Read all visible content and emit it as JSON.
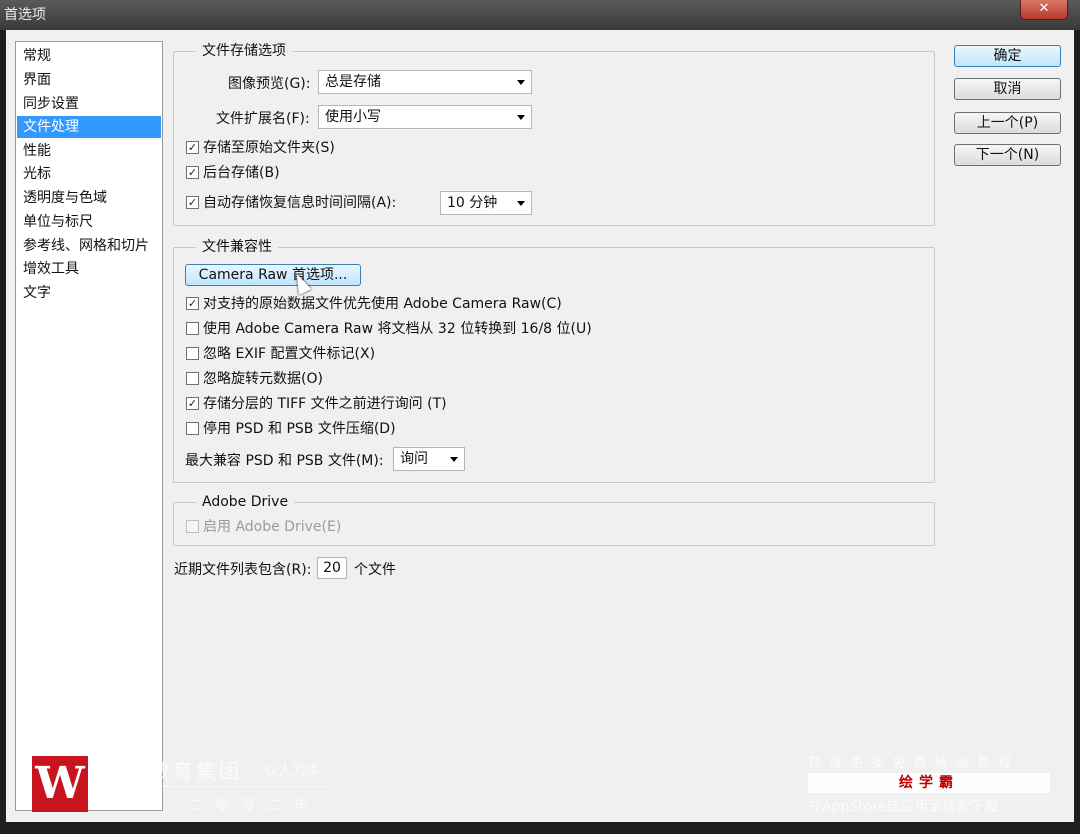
{
  "window": {
    "title": "首选项",
    "close_label": "✕"
  },
  "sidebar": {
    "items": [
      {
        "label": "常规"
      },
      {
        "label": "界面"
      },
      {
        "label": "同步设置"
      },
      {
        "label": "文件处理"
      },
      {
        "label": "性能"
      },
      {
        "label": "光标"
      },
      {
        "label": "透明度与色域"
      },
      {
        "label": "单位与标尺"
      },
      {
        "label": "参考线、网格和切片"
      },
      {
        "label": "增效工具"
      },
      {
        "label": "文字"
      }
    ],
    "selected": "文件处理"
  },
  "file_save": {
    "legend": "文件存储选项",
    "image_preview_label": "图像预览(G):",
    "image_preview_value": "总是存储",
    "extension_label": "文件扩展名(F):",
    "extension_value": "使用小写",
    "save_to_original": {
      "label": "存储至原始文件夹(S)",
      "checked": true
    },
    "background_save": {
      "label": "后台存储(B)",
      "checked": true
    },
    "auto_save": {
      "label": "自动存储恢复信息时间间隔(A):",
      "checked": true
    },
    "auto_save_interval": "10 分钟"
  },
  "compat": {
    "legend": "文件兼容性",
    "camera_raw_button": "Camera Raw 首选项...",
    "options": [
      {
        "label": "对支持的原始数据文件优先使用 Adobe Camera Raw(C)",
        "checked": true
      },
      {
        "label": "使用 Adobe Camera Raw 将文档从 32 位转换到 16/8 位(U)",
        "checked": false
      },
      {
        "label": "忽略 EXIF 配置文件标记(X)",
        "checked": false
      },
      {
        "label": "忽略旋转元数据(O)",
        "checked": false
      },
      {
        "label": "存储分层的 TIFF 文件之前进行询问 (T)",
        "checked": true
      },
      {
        "label": "停用 PSD 和 PSB 文件压缩(D)",
        "checked": false
      }
    ],
    "max_compat_label": "最大兼容 PSD 和 PSB 文件(M):",
    "max_compat_value": "询问"
  },
  "adobe_drive": {
    "legend": "Adobe Drive",
    "enable": {
      "label": "启用 Adobe Drive(E)",
      "checked": false,
      "disabled": true
    }
  },
  "recent": {
    "label": "近期文件列表包含(R):",
    "value": "20",
    "suffix": "个文件"
  },
  "buttons": {
    "ok": "确定",
    "cancel": "取消",
    "prev": "上一个(P)",
    "next": "下一个(N)"
  },
  "watermark": {
    "logo_letter": "W",
    "org": "教育集团",
    "motto": "以人为本",
    "year": "二 零 零 二 年",
    "promo_line1": "获 得 更 多 免 费 精 品 教 程",
    "promo_brand": "绘学霸",
    "promo_line2": "在AppStore或应用宝搜索下载"
  },
  "check_glyph": "✓"
}
